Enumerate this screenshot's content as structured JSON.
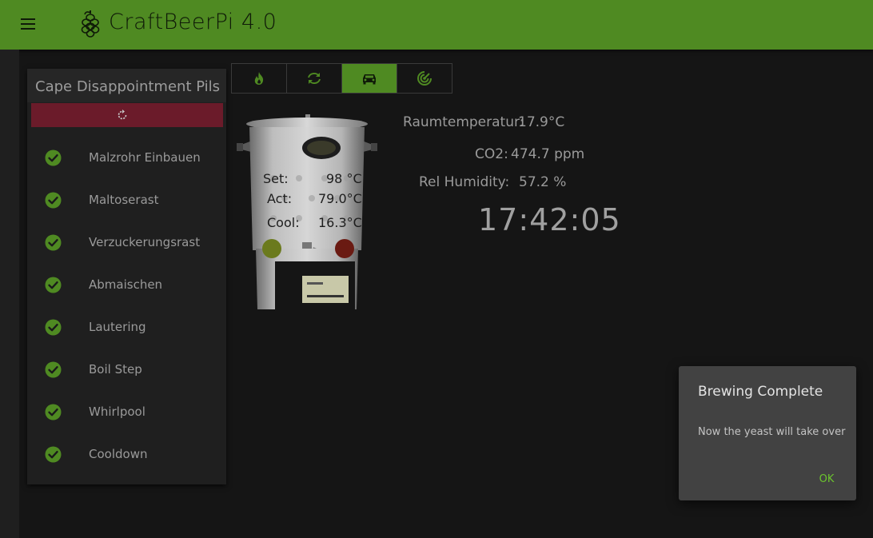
{
  "header": {
    "title": "CraftBeerPi 4.0",
    "menu_icon": "hamburger-menu-icon",
    "logo_icon": "hop-icon",
    "bar_color": "#4f8a22"
  },
  "recipe": {
    "name": "Cape Disappointment Pils",
    "reset_icon": "refresh-icon",
    "reset_color": "#6b1b2a",
    "steps": [
      {
        "label": "Malzrohr Einbauen",
        "status": "done"
      },
      {
        "label": "Maltoserast",
        "status": "done"
      },
      {
        "label": "Verzuckerungsrast",
        "status": "done"
      },
      {
        "label": "Abmaischen",
        "status": "done"
      },
      {
        "label": "Lautering",
        "status": "done"
      },
      {
        "label": "Boil Step",
        "status": "done"
      },
      {
        "label": "Whirlpool",
        "status": "done"
      },
      {
        "label": "Cooldown",
        "status": "done"
      }
    ]
  },
  "tabs": [
    {
      "icon": "flame-icon",
      "active": false
    },
    {
      "icon": "sync-icon",
      "active": false
    },
    {
      "icon": "car-icon",
      "active": true
    },
    {
      "icon": "radar-icon",
      "active": false
    }
  ],
  "kettle": {
    "set_label": "Set:",
    "set_value": "98 °C",
    "act_label": "Act:",
    "act_value": "79.0°C",
    "cool_label": "Cool:",
    "cool_value": "16.3°C",
    "led_left_color": "#6b7a1d",
    "led_right_color": "#6a1a12"
  },
  "sensors": {
    "room_label": "Raumtemperatur:",
    "room_value": "17.9°C",
    "co2_label": "CO2:",
    "co2_value": "474.7 ppm",
    "humidity_label": "Rel Humidity:",
    "humidity_value": "57.2 %",
    "clock": "17:42:05"
  },
  "dialog": {
    "title": "Brewing Complete",
    "message": "Now the yeast will take over",
    "ok_label": "OK"
  }
}
